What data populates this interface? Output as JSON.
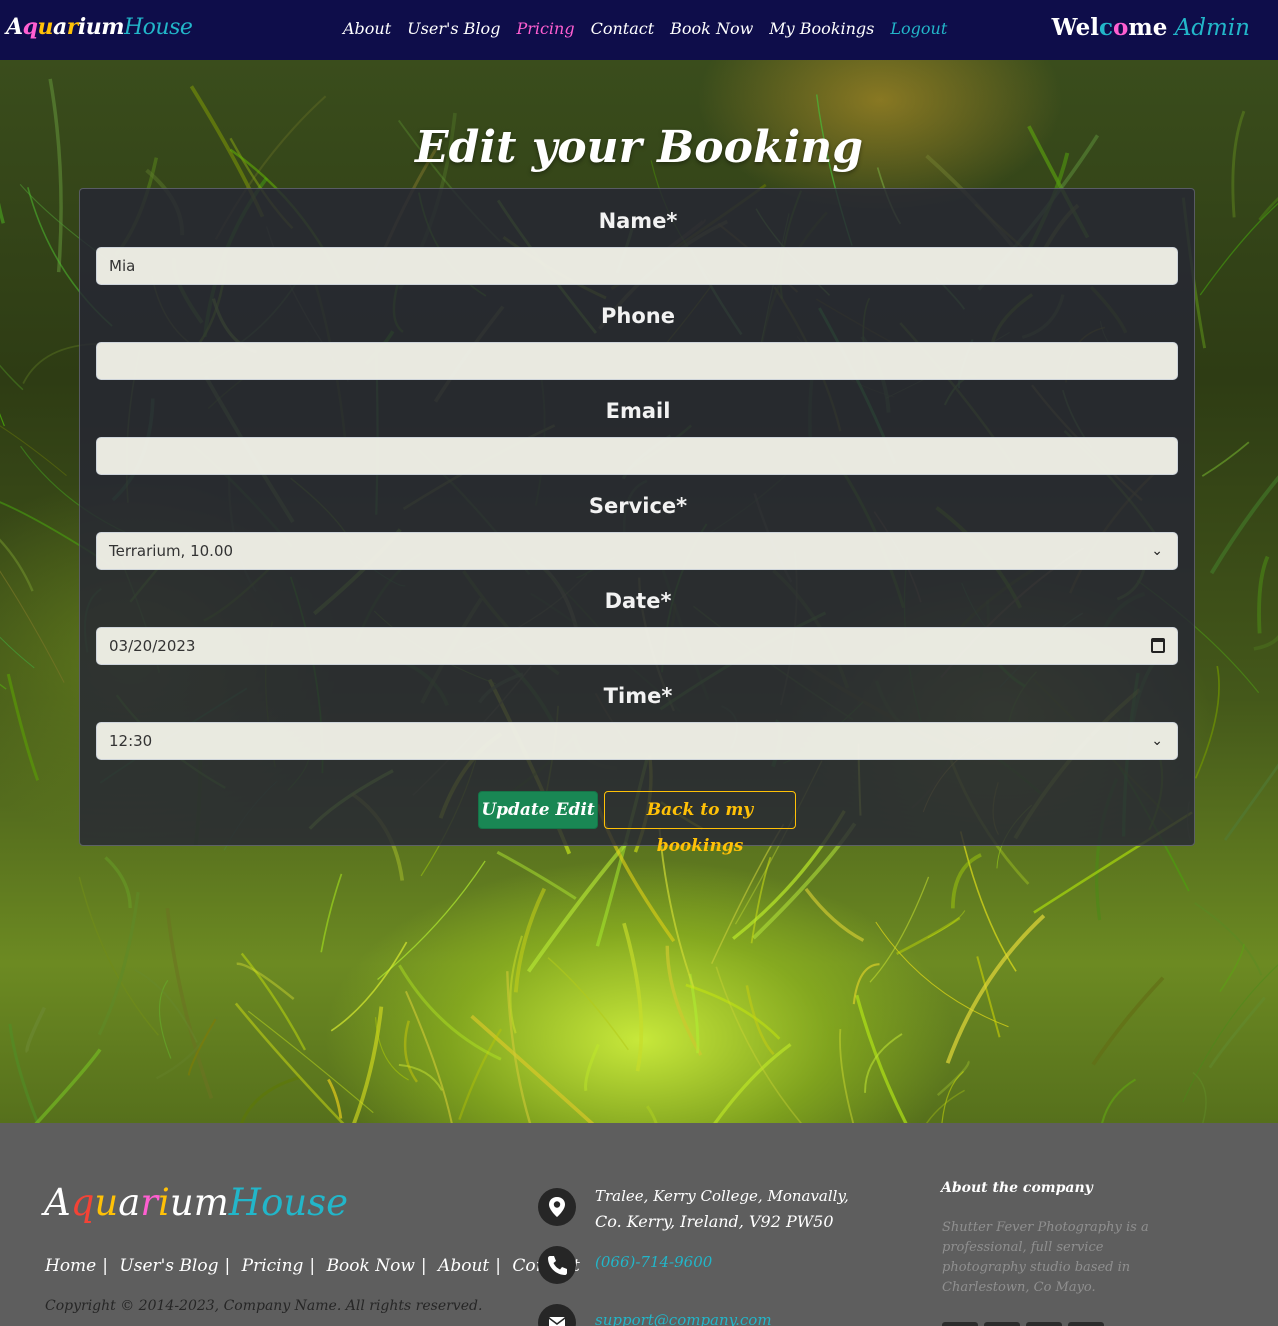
{
  "navbar": {
    "brand": "AquariumHouse",
    "links": [
      {
        "label": "About",
        "color": "#ffffff"
      },
      {
        "label": "User's Blog",
        "color": "#ffffff"
      },
      {
        "label": "Pricing",
        "color": "#ff5fd1"
      },
      {
        "label": "Contact",
        "color": "#ffffff"
      },
      {
        "label": "Book Now",
        "color": "#ffffff"
      },
      {
        "label": "My Bookings",
        "color": "#ffffff"
      },
      {
        "label": "Logout",
        "color": "#22b6c9"
      }
    ],
    "welcome_label": "Welcome",
    "welcome_user": "Admin",
    "colors": {
      "background": "#0e0d4a",
      "accent": "#22b6c9"
    }
  },
  "main": {
    "title": "Edit your Booking",
    "form": {
      "name_label": "Name*",
      "name_value": "Mia",
      "phone_label": "Phone",
      "phone_value": "",
      "email_label": "Email",
      "email_value": "",
      "service_label": "Service*",
      "service_value": "Terrarium, 10.00",
      "date_label": "Date*",
      "date_value": "03/20/2023",
      "time_label": "Time*",
      "time_value": "12:30",
      "update_button": "Update Edit",
      "back_button": "Back to my bookings"
    },
    "colors": {
      "update": "#198754",
      "back": "#ffc107"
    }
  },
  "footer": {
    "brand": "AquariumHouse",
    "links": [
      "Home",
      "User's Blog",
      "Pricing",
      "Book Now",
      "About",
      "Contact"
    ],
    "copyright": "Copyright © 2014-2023, Company Name. All rights reserved.",
    "address_line1": "Tralee, Kerry College, Monavally,",
    "address_line2": "Co. Kerry, Ireland, V92 PW50",
    "phone": "(066)-714-9600",
    "email": "support@company.com",
    "about_heading": "About the company",
    "about_text": "Shutter Fever Photography is a professional, full service photography studio based in Charlestown, Co Mayo.",
    "icons": [
      "map-marker-icon",
      "phone-icon",
      "envelope-icon"
    ]
  }
}
